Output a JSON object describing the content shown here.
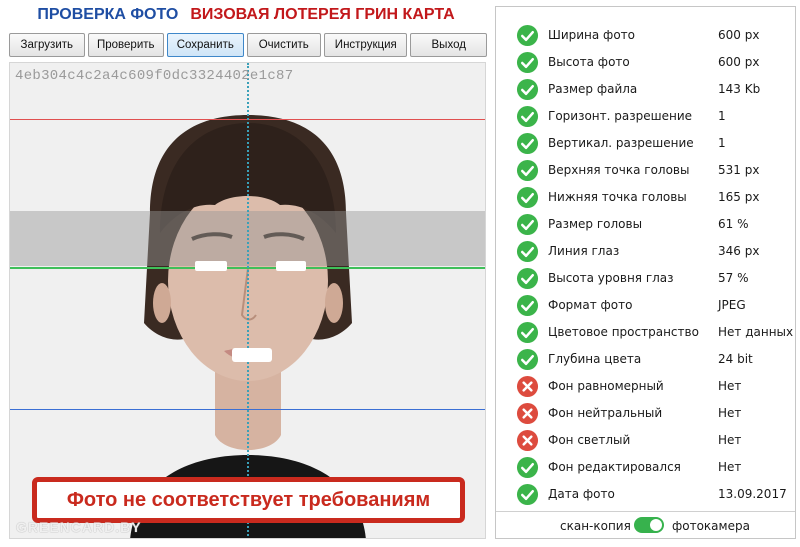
{
  "header": {
    "title_left": "ПРОВЕРКА ФОТО",
    "title_right": "ВИЗОВАЯ ЛОТЕРЕЯ ГРИН КАРТА"
  },
  "toolbar": {
    "buttons": [
      {
        "label": "Загрузить"
      },
      {
        "label": "Проверить"
      },
      {
        "label": "Сохранить"
      },
      {
        "label": "Очистить"
      },
      {
        "label": "Инструкция"
      },
      {
        "label": "Выход"
      }
    ]
  },
  "photo": {
    "hash": "4eb304c4c2a4c609f0dc3324402e1c87",
    "verdict": "Фото не соответствует требованиям",
    "watermark": "GREENCARD.BY"
  },
  "checks": [
    {
      "label": "Ширина фото",
      "value": "600 px",
      "status": "ok"
    },
    {
      "label": "Высота фото",
      "value": "600 px",
      "status": "ok"
    },
    {
      "label": "Размер файла",
      "value": "143 Kb",
      "status": "ok"
    },
    {
      "label": "Горизонт. разрешение",
      "value": "1",
      "status": "ok"
    },
    {
      "label": "Вертикал. разрешение",
      "value": "1",
      "status": "ok"
    },
    {
      "label": "Верхняя точка головы",
      "value": "531 px",
      "status": "ok"
    },
    {
      "label": "Нижняя точка головы",
      "value": "165 px",
      "status": "ok"
    },
    {
      "label": "Размер головы",
      "value": "61 %",
      "status": "ok"
    },
    {
      "label": "Линия глаз",
      "value": "346 px",
      "status": "ok"
    },
    {
      "label": "Высота уровня глаз",
      "value": "57 %",
      "status": "ok"
    },
    {
      "label": "Формат фото",
      "value": "JPEG",
      "status": "ok"
    },
    {
      "label": "Цветовое пространство",
      "value": "Нет данных",
      "status": "ok"
    },
    {
      "label": "Глубина цвета",
      "value": "24 bit",
      "status": "ok"
    },
    {
      "label": "Фон равномерный",
      "value": "Нет",
      "status": "fail"
    },
    {
      "label": "Фон нейтральный",
      "value": "Нет",
      "status": "fail"
    },
    {
      "label": "Фон светлый",
      "value": "Нет",
      "status": "fail"
    },
    {
      "label": "Фон редактировался",
      "value": "Нет",
      "status": "ok"
    },
    {
      "label": "Дата фото",
      "value": "13.09.2017",
      "status": "ok"
    }
  ],
  "mode_toggle": {
    "left_label": "скан-копия",
    "right_label": "фотокамера",
    "state": "фотокамера"
  },
  "colors": {
    "ok": "#3bb44a",
    "fail": "#dd4b3e",
    "title_blue": "#1f4ea3",
    "title_red": "#c2181b"
  }
}
